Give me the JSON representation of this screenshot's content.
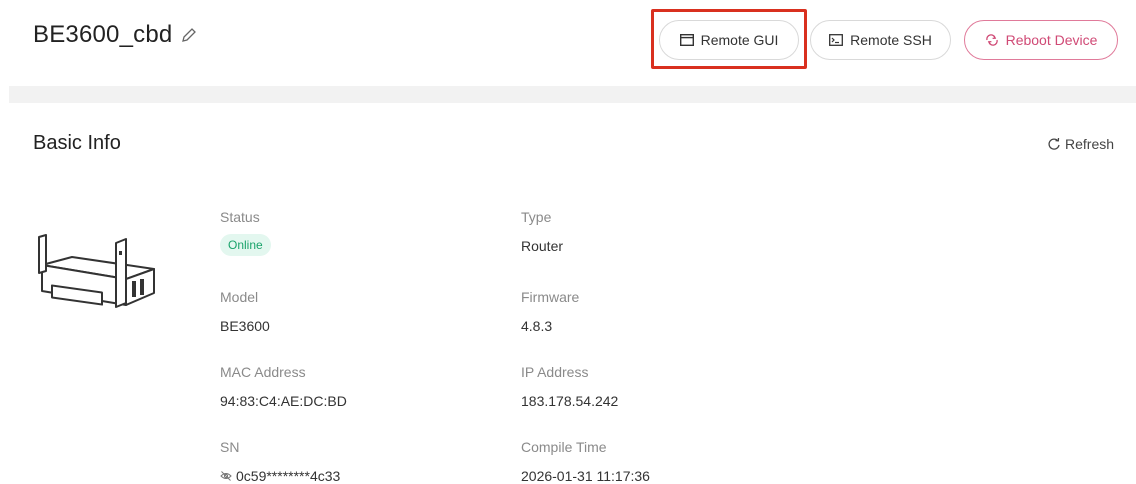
{
  "header": {
    "title": "BE3600_cbd",
    "buttons": {
      "remote_gui": "Remote GUI",
      "remote_ssh": "Remote SSH",
      "reboot": "Reboot Device"
    }
  },
  "basic_info": {
    "title": "Basic Info",
    "refresh": "Refresh",
    "status": {
      "label": "Status",
      "value": "Online"
    },
    "type": {
      "label": "Type",
      "value": "Router"
    },
    "model": {
      "label": "Model",
      "value": "BE3600"
    },
    "firmware": {
      "label": "Firmware",
      "value": "4.8.3"
    },
    "mac": {
      "label": "MAC Address",
      "value": "94:83:C4:AE:DC:BD"
    },
    "ip": {
      "label": "IP Address",
      "value": "183.178.54.242"
    },
    "sn": {
      "label": "SN",
      "value": "0c59********4c33"
    },
    "compile_time": {
      "label": "Compile Time",
      "value": "2026-01-31 11:17:36"
    }
  },
  "colors": {
    "highlight": "#d9301f",
    "reboot": "#d04a76",
    "online_bg": "#e3f7ef",
    "online_text": "#1aa36b"
  },
  "icons": [
    "pencil-icon",
    "window-icon",
    "terminal-icon",
    "reboot-icon",
    "refresh-icon",
    "eye-slash-icon"
  ]
}
